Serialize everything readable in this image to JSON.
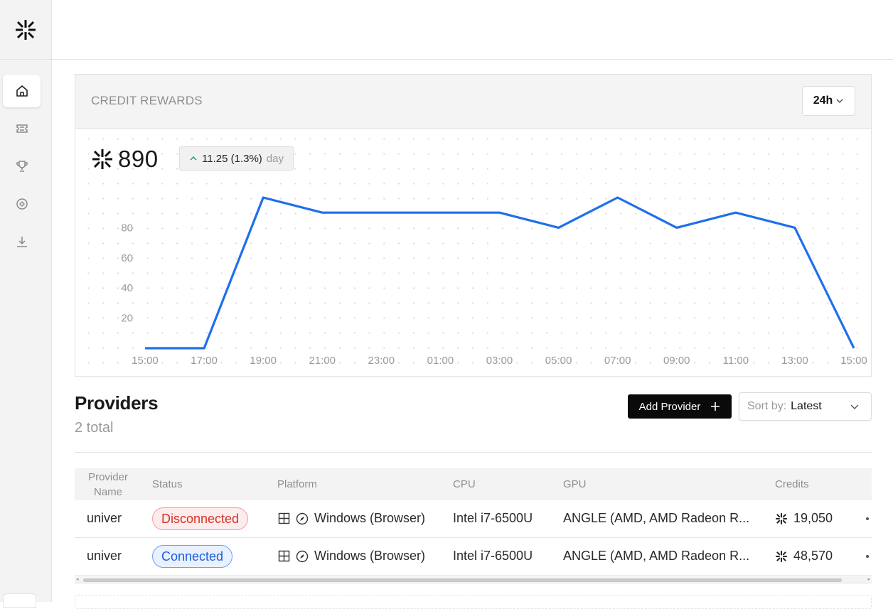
{
  "sidebar": {
    "logo_icon": "asterisk-logo",
    "items": [
      {
        "name": "home",
        "icon": "home-icon",
        "active": true
      },
      {
        "name": "tickets",
        "icon": "ticket-icon",
        "active": false
      },
      {
        "name": "trophy",
        "icon": "trophy-icon",
        "active": false
      },
      {
        "name": "target",
        "icon": "target-icon",
        "active": false
      },
      {
        "name": "download",
        "icon": "download-icon",
        "active": false
      }
    ]
  },
  "rewards": {
    "title": "CREDIT REWARDS",
    "range": "24h",
    "balance": "890",
    "change": "11.25 (1.3%)",
    "change_period": "day",
    "change_direction": "up",
    "accent_color": "#1f6feb"
  },
  "chart_data": {
    "type": "line",
    "x": [
      "15:00",
      "16:00",
      "17:00",
      "18:00",
      "19:00",
      "20:00",
      "21:00",
      "22:00",
      "23:00",
      "00:00",
      "01:00",
      "02:00",
      "03:00",
      "04:00",
      "05:00",
      "06:00",
      "07:00",
      "08:00",
      "09:00",
      "10:00",
      "11:00",
      "12:00",
      "13:00",
      "14:00",
      "15:00"
    ],
    "xticks": [
      "15:00",
      "17:00",
      "19:00",
      "21:00",
      "23:00",
      "01:00",
      "03:00",
      "05:00",
      "07:00",
      "09:00",
      "11:00",
      "13:00",
      "15:00"
    ],
    "values": [
      0,
      0,
      0,
      50,
      100,
      95,
      90,
      90,
      90,
      90,
      90,
      90,
      90,
      85,
      80,
      90,
      100,
      90,
      80,
      85,
      90,
      85,
      80,
      40,
      0
    ],
    "yticks": [
      20,
      40,
      60,
      80
    ],
    "ylim": [
      0,
      100
    ],
    "grid": "dotted",
    "series": [
      {
        "values": [
          0,
          0,
          0,
          50,
          100,
          95,
          90,
          90,
          90,
          90,
          90,
          90,
          90,
          85,
          80,
          90,
          100,
          90,
          80,
          85,
          90,
          85,
          80,
          40,
          0
        ],
        "color": "#1f6feb"
      }
    ]
  },
  "providers": {
    "title": "Providers",
    "count": "2 total",
    "add_label": "Add Provider",
    "sort_label": "Sort by:",
    "sort_value": "Latest",
    "columns": {
      "provider_name": "Provider Name",
      "status": "Status",
      "platform": "Platform",
      "cpu": "CPU",
      "gpu": "GPU",
      "credits": "Credits"
    },
    "rows": [
      {
        "name": "univer",
        "status": "Disconnected",
        "status_kind": "error",
        "platform": "Windows (Browser)",
        "cpu": "Intel i7-6500U",
        "gpu": "ANGLE (AMD, AMD Radeon R...",
        "credits": "19,050"
      },
      {
        "name": "univer",
        "status": "Connected",
        "status_kind": "success",
        "platform": "Windows (Browser)",
        "cpu": "Intel i7-6500U",
        "gpu": "ANGLE (AMD, AMD Radeon R...",
        "credits": "48,570"
      }
    ]
  },
  "colors": {
    "error": "#d93025",
    "success": "#1a5fe0",
    "sidebar_bg": "#f3f3f3"
  }
}
